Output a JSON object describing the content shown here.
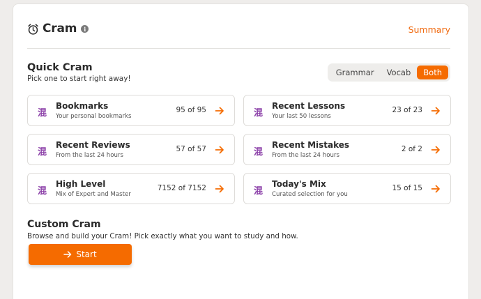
{
  "header": {
    "title": "Cram",
    "summary_label": "Summary"
  },
  "quick_cram": {
    "title": "Quick Cram",
    "subtitle": "Pick one to start right away!",
    "filter": {
      "options": [
        "Grammar",
        "Vocab",
        "Both"
      ],
      "selected": "Both"
    },
    "tiles": [
      {
        "glyph": "混",
        "title": "Bookmarks",
        "subtitle": "Your personal bookmarks",
        "count": "95 of 95"
      },
      {
        "glyph": "混",
        "title": "Recent Lessons",
        "subtitle": "Your last 50 lessons",
        "count": "23 of 23"
      },
      {
        "glyph": "混",
        "title": "Recent Reviews",
        "subtitle": "From the last 24 hours",
        "count": "57 of 57"
      },
      {
        "glyph": "混",
        "title": "Recent Mistakes",
        "subtitle": "From the last 24 hours",
        "count": "2 of 2"
      },
      {
        "glyph": "混",
        "title": "High Level",
        "subtitle": "Mix of Expert and Master",
        "count": "7152 of 7152"
      },
      {
        "glyph": "混",
        "title": "Today's Mix",
        "subtitle": "Curated selection for you",
        "count": "15 of 15"
      }
    ]
  },
  "custom_cram": {
    "title": "Custom Cram",
    "subtitle": "Browse and build your Cram! Pick exactly what you want to study and how.",
    "start_label": "Start"
  },
  "colors": {
    "accent": "#f56b00",
    "kanji": "#8b3fa8",
    "background": "#efedeb"
  }
}
